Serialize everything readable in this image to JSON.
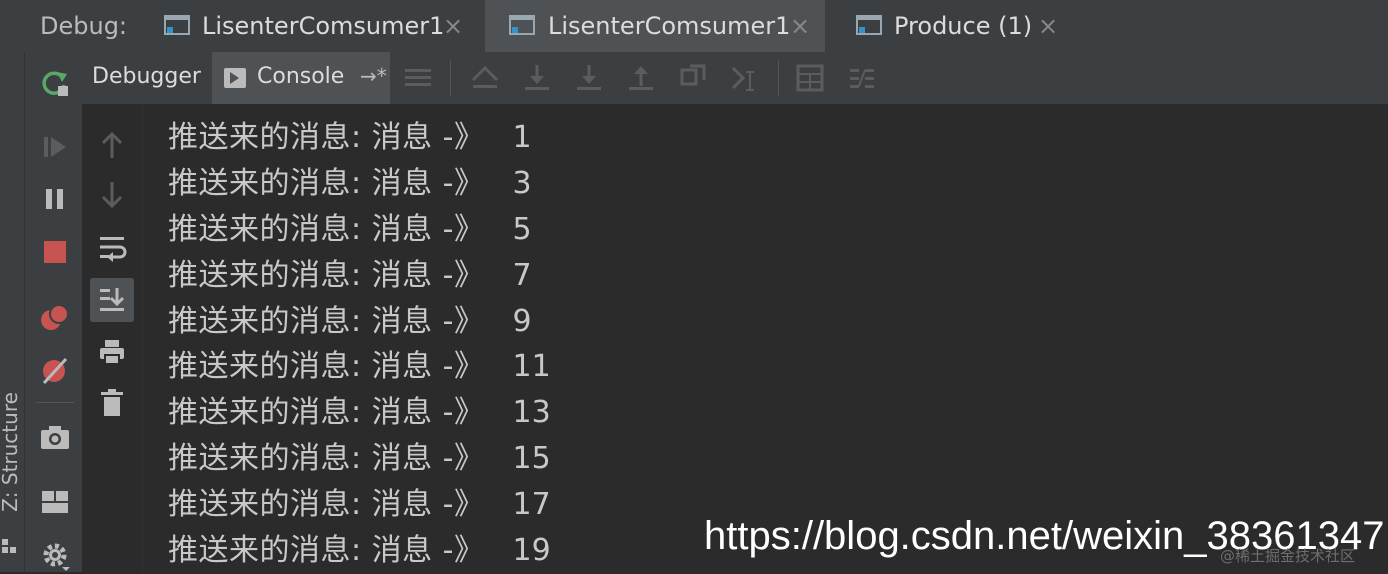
{
  "header": {
    "debug_label": "Debug:",
    "tabs": [
      {
        "label": "LisenterComsumer1",
        "close": "×"
      },
      {
        "label": "LisenterComsumer1",
        "close": "×"
      },
      {
        "label": "Produce (1)",
        "close": "×"
      }
    ]
  },
  "toolbar": {
    "debugger_tab": "Debugger",
    "console_tab": "Console",
    "console_pin": "→*"
  },
  "left_strip": {
    "structure_label": "Z: Structure"
  },
  "console": {
    "lines": [
      {
        "prefix": "推送来的消息: 消息 -》",
        "value": "1"
      },
      {
        "prefix": "推送来的消息: 消息 -》",
        "value": "3"
      },
      {
        "prefix": "推送来的消息: 消息 -》",
        "value": "5"
      },
      {
        "prefix": "推送来的消息: 消息 -》",
        "value": "7"
      },
      {
        "prefix": "推送来的消息: 消息 -》",
        "value": "9"
      },
      {
        "prefix": "推送来的消息: 消息 -》",
        "value": "11"
      },
      {
        "prefix": "推送来的消息: 消息 -》",
        "value": "13"
      },
      {
        "prefix": "推送来的消息: 消息 -》",
        "value": "15"
      },
      {
        "prefix": "推送来的消息: 消息 -》",
        "value": "17"
      },
      {
        "prefix": "推送来的消息: 消息 -》",
        "value": "19"
      }
    ]
  },
  "watermark": {
    "url": "https://blog.csdn.net/weixin_38361347",
    "small": "@稀土掘金技术社区"
  },
  "colors": {
    "background": "#2b2b2b",
    "panel": "#3c3f41",
    "active_tab": "#4e5254",
    "rerun_green": "#59a869",
    "stop_red": "#c75450",
    "text": "#bbbbbb"
  },
  "icons": {
    "rerun": "rerun-icon",
    "resume": "resume-icon",
    "pause": "pause-icon",
    "stop": "stop-icon",
    "breakpoints": "view-breakpoints-icon",
    "mute": "mute-breakpoints-icon",
    "camera": "camera-icon",
    "layout": "layout-icon",
    "settings": "gear-icon"
  }
}
